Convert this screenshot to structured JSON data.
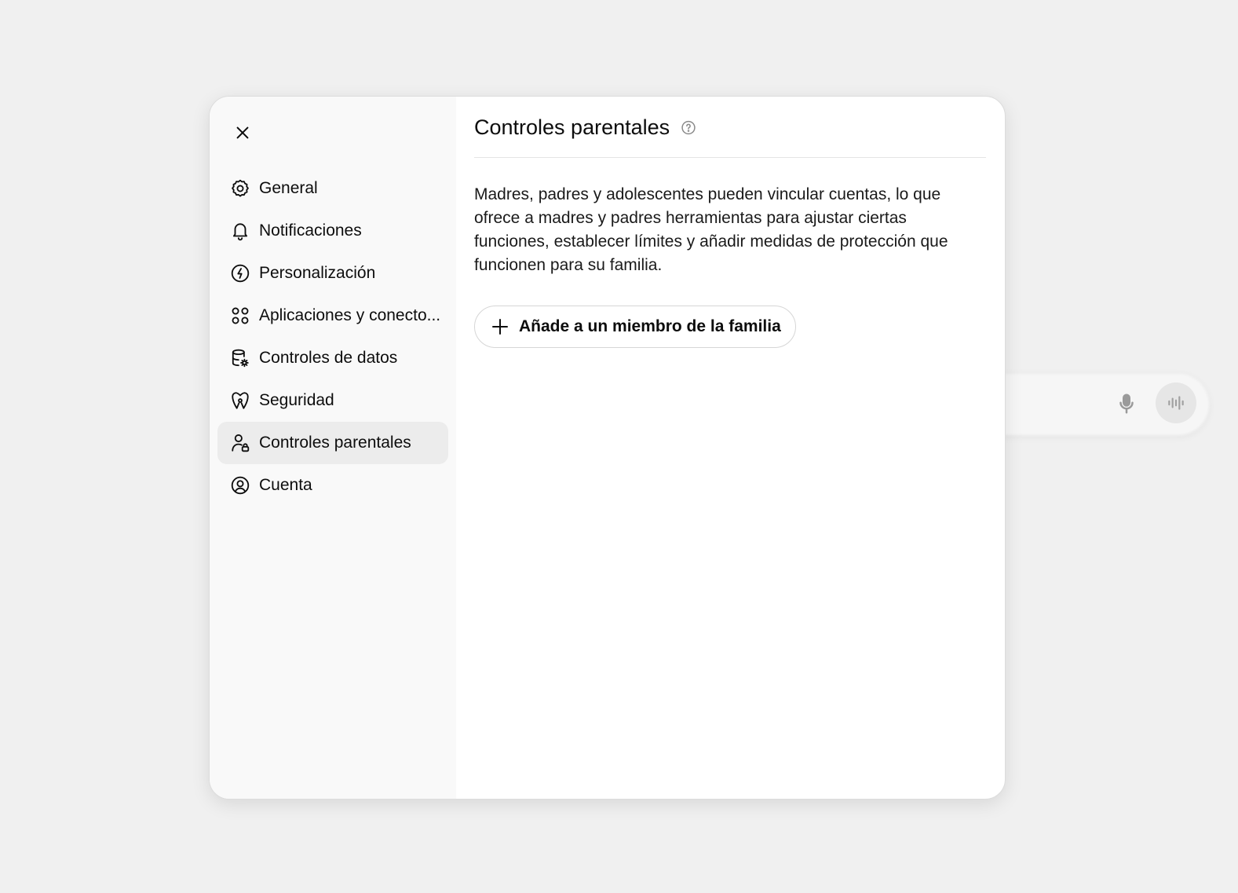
{
  "sidebar": {
    "items": [
      {
        "label": "General",
        "icon": "gear-icon"
      },
      {
        "label": "Notificaciones",
        "icon": "bell-icon"
      },
      {
        "label": "Personalización",
        "icon": "personalization-icon"
      },
      {
        "label": "Aplicaciones y conecto...",
        "icon": "apps-icon"
      },
      {
        "label": "Controles de datos",
        "icon": "database-gear-icon"
      },
      {
        "label": "Seguridad",
        "icon": "shield-lock-icon"
      },
      {
        "label": "Controles parentales",
        "icon": "user-lock-icon",
        "active": true
      },
      {
        "label": "Cuenta",
        "icon": "user-circle-icon"
      }
    ]
  },
  "content": {
    "title": "Controles parentales",
    "description": "Madres, padres y adolescentes pueden vincular cuentas, lo que ofrece a madres y padres herramientas para ajustar ciertas funciones, establecer límites y añadir medidas de protección que funcionen para su familia.",
    "add_button_label": "Añade a un miembro de la familia"
  },
  "colors": {
    "active_item_bg": "#ececec",
    "sidebar_bg": "#f9f9f9",
    "page_bg": "#f0f0f0"
  }
}
